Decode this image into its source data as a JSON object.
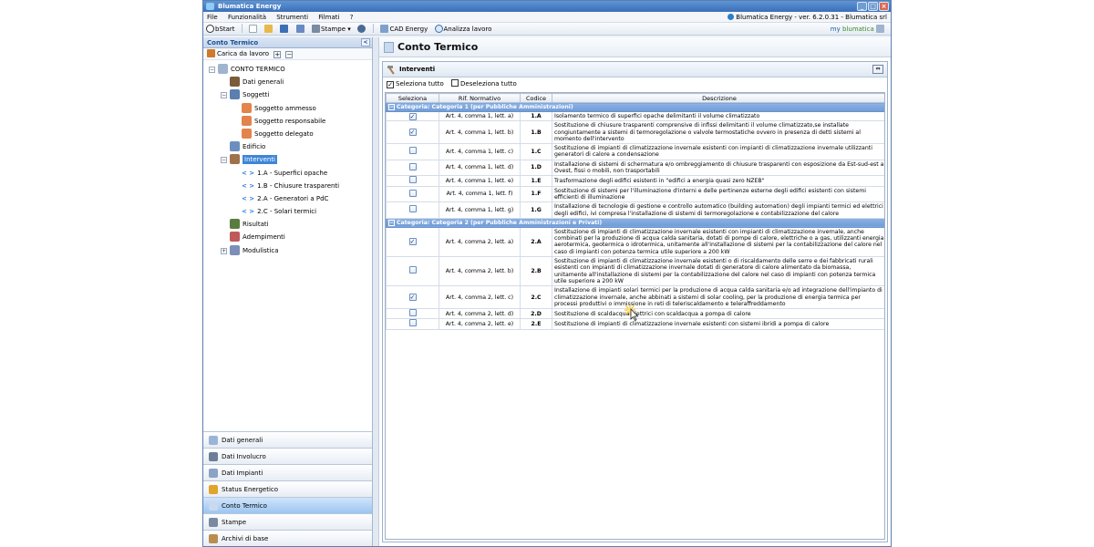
{
  "app": {
    "title": "Blumatica Energy",
    "version": "Blumatica Energy - ver. 6.2.0.31 - Blumatica srl"
  },
  "menu": [
    "File",
    "Funzionalità",
    "Strumenti",
    "Filmati",
    "?"
  ],
  "toolbar": {
    "bstart": "bStart",
    "stampe": "Stampe",
    "cad": "CAD Energy",
    "analizza": "Analizza lavoro",
    "brand_pre": "my",
    "brand": "blumatica"
  },
  "left": {
    "title": "Conto Termico",
    "load_label": "Carica da lavoro",
    "tree": [
      {
        "label": "CONTO TERMICO",
        "level": 0,
        "toggle": "−",
        "icon": "document-icon",
        "color": "#9fb4cf"
      },
      {
        "label": "Dati generali",
        "level": 1,
        "toggle": "",
        "icon": "data-icon",
        "color": "#7a5c3b"
      },
      {
        "label": "Soggetti",
        "level": 1,
        "toggle": "−",
        "icon": "users-icon",
        "color": "#5b7fae"
      },
      {
        "label": "Soggetto ammesso",
        "level": 2,
        "toggle": "",
        "icon": "person-icon",
        "color": "#e2844b"
      },
      {
        "label": "Soggetto responsabile",
        "level": 2,
        "toggle": "",
        "icon": "person-icon",
        "color": "#e2844b"
      },
      {
        "label": "Soggetto delegato",
        "level": 2,
        "toggle": "",
        "icon": "person-icon",
        "color": "#e2844b"
      },
      {
        "label": "Edificio",
        "level": 1,
        "toggle": "",
        "icon": "building-icon",
        "color": "#6d8fc0"
      },
      {
        "label": "Interventi",
        "level": 1,
        "toggle": "−",
        "icon": "hammer-icon",
        "color": "#a0724a",
        "selected": true
      },
      {
        "code": "< >",
        "label": "1.A - Superfici opache",
        "level": 2,
        "toggle": "",
        "icon": "code-icon",
        "color": ""
      },
      {
        "code": "< >",
        "label": "1.B - Chiusure trasparenti",
        "level": 2,
        "toggle": "",
        "icon": "code-icon",
        "color": ""
      },
      {
        "code": "< >",
        "label": "2.A - Generatori a PdC",
        "level": 2,
        "toggle": "",
        "icon": "code-icon",
        "color": ""
      },
      {
        "code": "< >",
        "label": "2.C - Solari termici",
        "level": 2,
        "toggle": "",
        "icon": "code-icon",
        "color": ""
      },
      {
        "label": "Risultati",
        "level": 1,
        "toggle": "",
        "icon": "results-icon",
        "color": "#5a7d3f"
      },
      {
        "label": "Adempimenti",
        "level": 1,
        "toggle": "",
        "icon": "tasks-icon",
        "color": "#c05a5a"
      },
      {
        "label": "Modulistica",
        "level": 1,
        "toggle": "+",
        "icon": "forms-icon",
        "color": "#7c8fb8"
      }
    ]
  },
  "nav": [
    {
      "label": "Dati generali",
      "icon": "data-icon",
      "color": "#9bb4d6"
    },
    {
      "label": "Dati Involucro",
      "icon": "envelope-icon",
      "color": "#6d7f96"
    },
    {
      "label": "Dati Impianti",
      "icon": "plant-icon",
      "color": "#8ca3c4"
    },
    {
      "label": "Status Energetico",
      "icon": "energy-icon",
      "color": "#e0a52a"
    },
    {
      "label": "Conto Termico",
      "icon": "conto-icon",
      "color": "#c9d9ee",
      "active": true
    },
    {
      "label": "Stampe",
      "icon": "print-icon",
      "color": "#7a8aa0"
    },
    {
      "label": "Archivi di base",
      "icon": "archive-icon",
      "color": "#b98d4f"
    }
  ],
  "main": {
    "title": "Conto Termico",
    "panel_title": "Interventi",
    "select_all": "Seleziona tutto",
    "deselect_all": "Deseleziona tutto",
    "columns": [
      "Seleziona",
      "Rif. Normativo",
      "Codice",
      "Descrizione"
    ],
    "groups": [
      {
        "label": "Categoria: Categoria 1 (per Pubbliche Amministrazioni)",
        "rows": [
          {
            "checked": true,
            "ref": "Art. 4, comma 1, lett. a)",
            "code": "1.A",
            "desc": "Isolamento termico di superfici opache delimitanti il volume climatizzato"
          },
          {
            "checked": true,
            "ref": "Art. 4, comma 1, lett. b)",
            "code": "1.B",
            "desc": "Sostituzione di chiusure trasparenti comprensive di infissi delimitanti il volume climatizzato,se installate congiuntamente a sistemi di termoregolazione o valvole termostatiche ovvero in presenza di detti sistemi al momento dell'intervento"
          },
          {
            "checked": false,
            "ref": "Art. 4, comma 1, lett. c)",
            "code": "1.C",
            "desc": "Sostituzione di impianti di climatizzazione invernale esistenti con impianti di climatizzazione invernale utilizzanti generatori di calore a condensazione"
          },
          {
            "checked": false,
            "ref": "Art. 4, comma 1, lett. d)",
            "code": "1.D",
            "desc": "Installazione di sistemi di schermatura e/o ombreggiamento di chiusure trasparenti con esposizione da Est-sud-est a Ovest, fissi o mobili, non trasportabili"
          },
          {
            "checked": false,
            "ref": "Art. 4, comma 1, lett. e)",
            "code": "1.E",
            "desc": "Trasformazione degli edifici esistenti in \"edifici a energia quasi zero NZEB\""
          },
          {
            "checked": false,
            "ref": "Art. 4, comma 1, lett. f)",
            "code": "1.F",
            "desc": "Sostituzione di sistemi per l'illuminazione d'interni e delle pertinenze esterne degli edifici esistenti con sistemi efficienti di illuminazione"
          },
          {
            "checked": false,
            "ref": "Art. 4, comma 1, lett. g)",
            "code": "1.G",
            "desc": "Installazione di tecnologie di gestione e controllo automatico (building automation) degli impianti termici ed elettrici degli edifici, ivi compresa l'installazione di sistemi di termoregolazione e contabilizzazione del calore"
          }
        ]
      },
      {
        "label": "Categoria: Categoria 2 (per Pubbliche Amministrazioni e Privati)",
        "rows": [
          {
            "checked": true,
            "ref": "Art. 4, comma 2, lett. a)",
            "code": "2.A",
            "desc": "Sostituzione di impianti di climatizzazione invernale esistenti con impianti di climatizzazione invernale, anche combinati per la produzione di acqua calda sanitaria, dotati di pompe di calore, elettriche o a gas, utilizzanti energia aerotermica, geotermica o idrotermica, unitamente all'installazione di sistemi per la contabilizzazione del calore nel caso di impianti con potenza termica utile superiore a 200 kW"
          },
          {
            "checked": false,
            "ref": "Art. 4, comma 2, lett. b)",
            "code": "2.B",
            "desc": "Sostituzione di impianti di climatizzazione invernale esistenti o di riscaldamento delle serre e dei fabbricati rurali esistenti con impianti di climatizzazione invernale dotati di generatore di calore alimentato da biomassa, unitamente all'installazione di sistemi per la contabilizzazione del calore nel caso di impianti con potenza termica utile superiore a 200 kW"
          },
          {
            "checked": true,
            "ref": "Art. 4, comma 2, lett. c)",
            "code": "2.C",
            "desc": "Installazione di impianti solari termici per la produzione di acqua calda sanitaria e/o ad integrazione dell'impianto di climatizzazione invernale, anche abbinati a sistemi di solar cooling, per la produzione di energia termica per processi produttivi o immissione in reti di teleriscaldamento e teleraffreddamento"
          },
          {
            "checked": false,
            "ref": "Art. 4, comma 2, lett. d)",
            "code": "2.D",
            "desc": "Sostituzione di scaldacqua elettrici con scaldacqua a pompa di calore"
          },
          {
            "checked": false,
            "ref": "Art. 4, comma 2, lett. e)",
            "code": "2.E",
            "desc": "Sostituzione di impianti di climatizzazione invernale esistenti con sistemi ibridi a pompa di calore"
          }
        ]
      }
    ]
  }
}
